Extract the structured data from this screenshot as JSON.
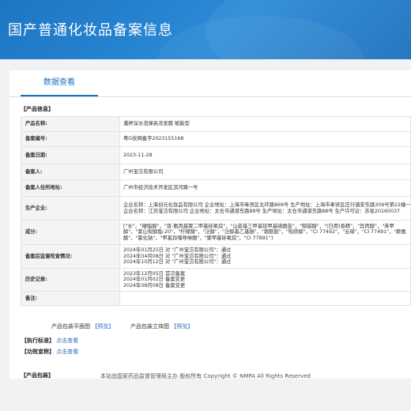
{
  "header": {
    "title": "国产普通化妆品备案信息"
  },
  "tabs": [
    "数据查看"
  ],
  "product_section": {
    "title": "【产品信息】",
    "rows": [
      {
        "label": "产品名称:",
        "value": "潘婷深水泡弹高浓发膜 赋能型"
      },
      {
        "label": "备案编号:",
        "value": "粤G妆网备字2023155168"
      },
      {
        "label": "备案日期:",
        "value": "2023-11-28"
      },
      {
        "label": "备案人:",
        "value": "广州宝洁有限公司"
      },
      {
        "label": "备案人住所地址:",
        "value": "广州市经济技术开发区滨河路一号"
      },
      {
        "label": "生产企业:",
        "lines": [
          "企业名称：上海创元化妆品有限公司 企业地址：上海市奉贤区北环路869号 生产地址：上海市奉贤区庄行镇安东路309号第22幢一、二、三、四层 生产许可证：沪妆20160004",
          "企业名称：江苏宝洁有限公司 企业地址：太仓市通港东路88号 生产地址：太仓市通港东路88号 生产许可证：苏妆20160037"
        ]
      },
      {
        "label": "成分:",
        "lines": [
          "[\"水\"，\"硬脂醇\"，\"双-氨丙基聚二甲基硅氧烷\"，\"山嵛基三甲基铵甲基硫酸盐\"，\"鲸蜡醇\"，\"(日用)香精\"，\"异丙醇\"，\"苯甲",
          "醇\"，\"紫山梨醇酯-20\"，\"柠檬酸\"，\"泛醇\"，\"泛醇基乙基醚\"，\"烟酰胺\"，\"吡哆醇\"，\"CI 77492\"，\"云母\"，\"CI 77491\"，\"赖氨",
          "酸\"，\"氯化钠\"，\"甲基异噻唑啉酮\"，\"聚甲基硅氧烷\"，\"CI 77891\"]"
        ]
      },
      {
        "label": "备案后监督检查情况:",
        "lines": [
          "2024年01月25日 对 \"广州宝洁有限公司\"：通过",
          "2024年04月08日 对 \"广州宝洁有限公司\"：通过",
          "2024年10月12日 对 \"广州宝洁有限公司\"：通过"
        ]
      },
      {
        "label": "历史记录:",
        "lines": [
          "2023年12月05日 首次备案",
          "2024年01月02日 备案变更",
          "2024年08月08日 备案变更"
        ]
      },
      {
        "label": "备注:",
        "value": ""
      }
    ]
  },
  "packaging_section": {
    "title": "【产品包装】",
    "flat_label": "产品包装平面图",
    "flat_link": "【预览】",
    "solid_label": "产品包装立体图",
    "solid_link": "【预览】"
  },
  "standard_section": {
    "title": "【执行标准】",
    "link": "点击查看"
  },
  "efficacy_section": {
    "title": "【功效宣称】",
    "link": "点击查看"
  },
  "footer": {
    "text": "本站由国家药品监督管理局主办 版权所有 Copyright © NMPA All Rights Reserved"
  }
}
